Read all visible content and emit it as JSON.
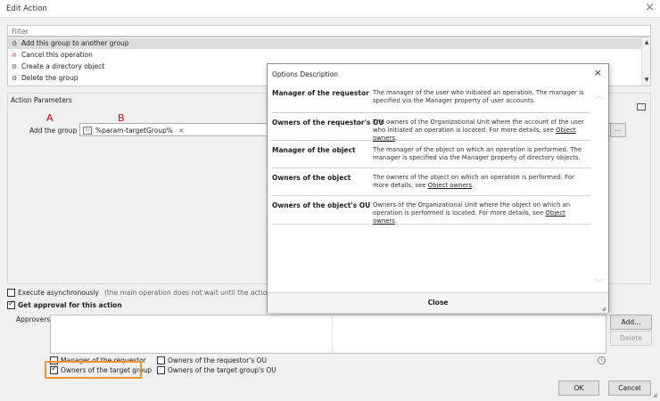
{
  "window": {
    "title": "Edit Action",
    "close_glyph": "×"
  },
  "filter": {
    "placeholder": "Filter"
  },
  "action_list": {
    "items": [
      {
        "label": "Add this group to another group",
        "icon": "gear-icon",
        "selected": true
      },
      {
        "label": "Cancel this operation",
        "icon": "cancel-icon",
        "selected": false
      },
      {
        "label": "Create a directory object",
        "icon": "gear-icon",
        "selected": false
      },
      {
        "label": "Delete the group",
        "icon": "gear-icon",
        "selected": false
      }
    ]
  },
  "action_parameters": {
    "heading": "Action Parameters",
    "marker_a": "A",
    "marker_b": "B",
    "field_label": "Add the group to",
    "field_value": "%param-targetGroup%",
    "remove_glyph": "×",
    "browse_label": "..."
  },
  "options": {
    "execute_async_label": "Execute asynchronously",
    "execute_async_note": "(the main operation does not wait until the action is executed)",
    "execute_async_checked": false,
    "approval_label": "Get approval for this action",
    "approval_checked": true
  },
  "approvers": {
    "label": "Approvers:",
    "add_button": "Add...",
    "delete_button": "Delete",
    "checkboxes": [
      {
        "label": "Manager of the requestor",
        "checked": false
      },
      {
        "label": "Owners of the requestor's OU",
        "checked": false
      },
      {
        "label": "Owners of the target group",
        "checked": true
      },
      {
        "label": "Owners of the target group's OU",
        "checked": false
      }
    ],
    "info_glyph": "i"
  },
  "footer": {
    "ok_button": "OK",
    "cancel_button": "Cancel"
  },
  "options_dialog": {
    "title": "Options Description",
    "close_glyph": "×",
    "close_button": "Close",
    "rows": [
      {
        "term": "Manager of the requestor",
        "desc_before": "The manager of the user who initiated an operation. The manager is specified via the Manager property of user accounts.",
        "link": "",
        "desc_after": ""
      },
      {
        "term": "Owners of the requestor's OU",
        "desc_before": "The owners of the Organizational Unit where the account of the user who initiated an operation is located. For more details, see ",
        "link": "Object owners",
        "desc_after": "."
      },
      {
        "term": "Manager of the object",
        "desc_before": "The manager of the object on which an operation is performed. The manager is specified via the Manager property of directory objects.",
        "link": "",
        "desc_after": ""
      },
      {
        "term": "Owners of the object",
        "desc_before": "The owners of the object on which an operation is performed. For more details, see ",
        "link": "Object owners",
        "desc_after": "."
      },
      {
        "term": "Owners of the object's OU",
        "desc_before": "Owners of the Organizational Unit where the object on which an operation is performed is located. For more details, see ",
        "link": "Object owners",
        "desc_after": "."
      }
    ]
  },
  "colors": {
    "highlight": "#f0922c",
    "marker": "#dd0000",
    "selection": "#dcdcdc"
  }
}
